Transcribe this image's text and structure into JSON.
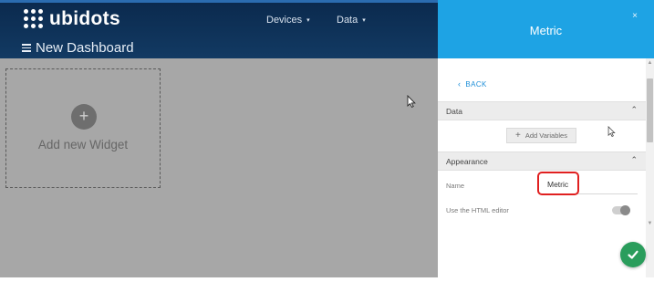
{
  "brand": {
    "name": "ubidots"
  },
  "nav": {
    "devices": "Devices",
    "data": "Data",
    "caret": "▾"
  },
  "dashboard": {
    "title": "New Dashboard",
    "add_widget_label": "Add new Widget",
    "add_widget_symbol": "+"
  },
  "panel": {
    "title": "Metric",
    "close": "×",
    "back": "BACK",
    "back_chevron": "‹",
    "sections": {
      "data": {
        "label": "Data",
        "arrow": "⌃"
      },
      "appearance": {
        "label": "Appearance",
        "arrow": "⌃"
      }
    },
    "add_variables": {
      "symbol": "+",
      "label": "Add Variables"
    },
    "fields": {
      "name_label": "Name",
      "name_value": "Metric",
      "html_editor_label": "Use the HTML editor",
      "html_editor_enabled": false
    }
  },
  "icons": {
    "hamburger": "hamburger-icon",
    "logo": "ubidots-logo-icon",
    "close": "close-icon",
    "back": "chevron-left-icon",
    "collapse": "chevron-up-icon",
    "add": "plus-icon",
    "save": "check-icon",
    "cursor": "mouse-pointer-icon"
  },
  "colors": {
    "nav_bg": "#0b2a4e",
    "panel_header": "#1ea3e4",
    "overlay": "#a7a7a7",
    "save_button": "#2a9d5c",
    "link": "#1e8fd8",
    "highlight": "#e02020"
  }
}
